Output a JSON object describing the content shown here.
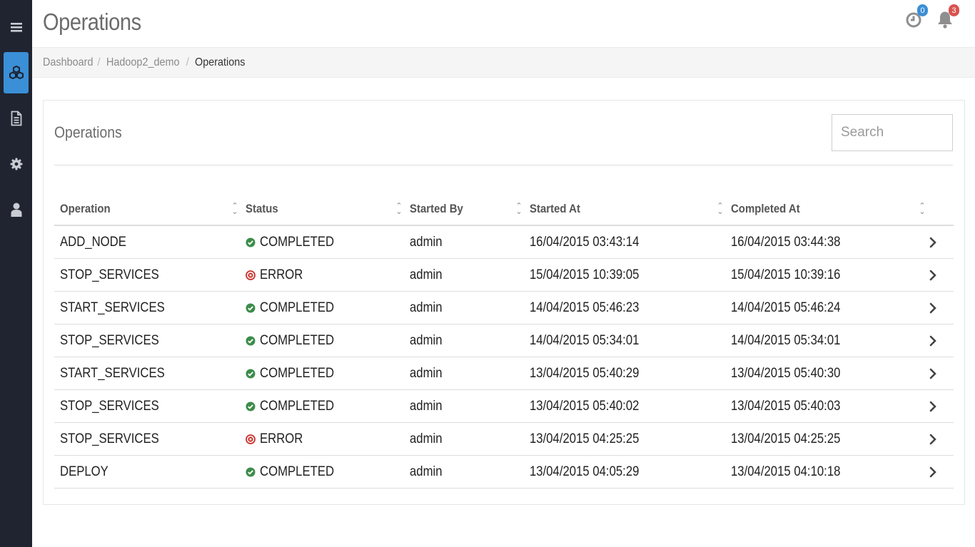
{
  "app": {
    "title": "Operations"
  },
  "sidebar": {
    "items": [
      {
        "name": "menu",
        "icon": "hamburger-icon"
      },
      {
        "name": "clusters",
        "icon": "cubes-icon",
        "active": true
      },
      {
        "name": "documents",
        "icon": "document-icon"
      },
      {
        "name": "settings",
        "icon": "gear-icon"
      },
      {
        "name": "users",
        "icon": "user-icon"
      }
    ]
  },
  "topbar": {
    "history_count": "0",
    "notifications_count": "3"
  },
  "breadcrumb": [
    "Dashboard",
    "Hadoop2_demo",
    "Operations"
  ],
  "panel": {
    "title": "Operations",
    "search_placeholder": "Search"
  },
  "table": {
    "columns": [
      "Operation",
      "Status",
      "Started By",
      "Started At",
      "Completed At"
    ],
    "rows": [
      {
        "operation": "ADD_NODE",
        "status": "COMPLETED",
        "started_by": "admin",
        "started_at": "16/04/2015 03:43:14",
        "completed_at": "16/04/2015 03:44:38"
      },
      {
        "operation": "STOP_SERVICES",
        "status": "ERROR",
        "started_by": "admin",
        "started_at": "15/04/2015 10:39:05",
        "completed_at": "15/04/2015 10:39:16"
      },
      {
        "operation": "START_SERVICES",
        "status": "COMPLETED",
        "started_by": "admin",
        "started_at": "14/04/2015 05:46:23",
        "completed_at": "14/04/2015 05:46:24"
      },
      {
        "operation": "STOP_SERVICES",
        "status": "COMPLETED",
        "started_by": "admin",
        "started_at": "14/04/2015 05:34:01",
        "completed_at": "14/04/2015 05:34:01"
      },
      {
        "operation": "START_SERVICES",
        "status": "COMPLETED",
        "started_by": "admin",
        "started_at": "13/04/2015 05:40:29",
        "completed_at": "13/04/2015 05:40:30"
      },
      {
        "operation": "STOP_SERVICES",
        "status": "COMPLETED",
        "started_by": "admin",
        "started_at": "13/04/2015 05:40:02",
        "completed_at": "13/04/2015 05:40:03"
      },
      {
        "operation": "STOP_SERVICES",
        "status": "ERROR",
        "started_by": "admin",
        "started_at": "13/04/2015 04:25:25",
        "completed_at": "13/04/2015 04:25:25"
      },
      {
        "operation": "DEPLOY",
        "status": "COMPLETED",
        "started_by": "admin",
        "started_at": "13/04/2015 04:05:29",
        "completed_at": "13/04/2015 04:10:18"
      }
    ]
  },
  "colors": {
    "sidebar_bg": "#1f2430",
    "accent": "#3a8fd6",
    "completed": "#3c8c4a",
    "error": "#c9302c",
    "badge_red": "#d9534f"
  }
}
